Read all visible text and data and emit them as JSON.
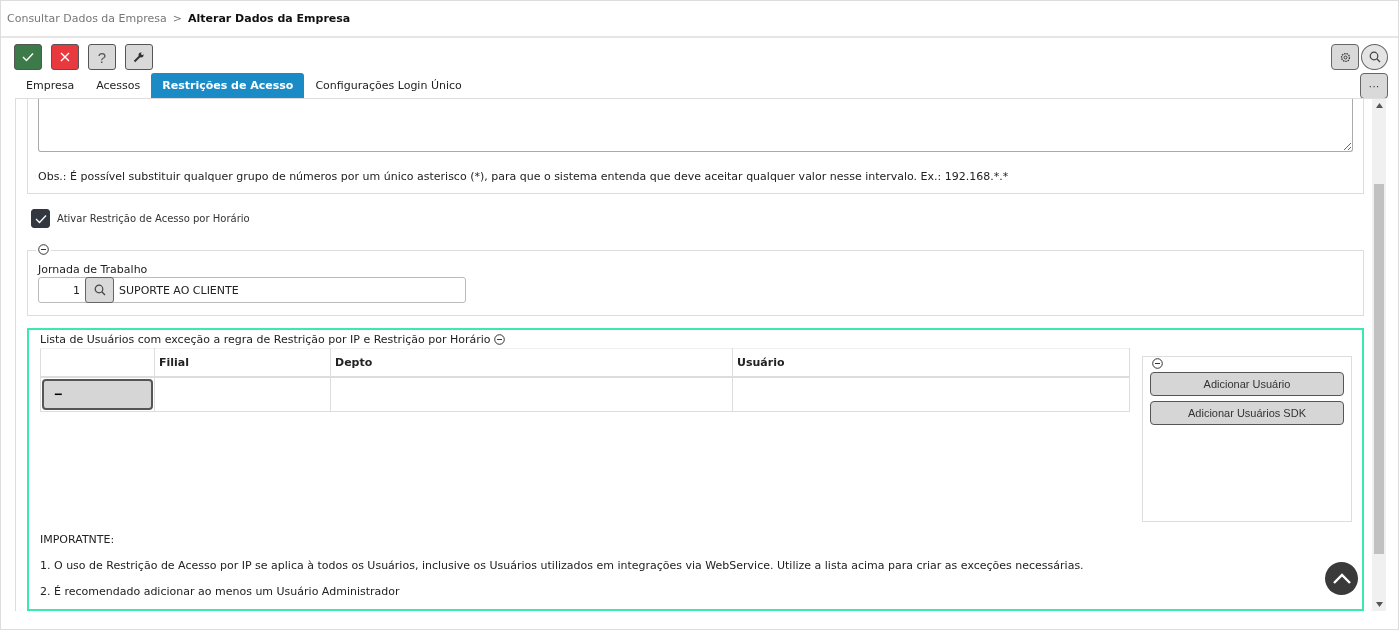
{
  "breadcrumb": [
    {
      "label": "Consultar Dados da Empresa",
      "current": false
    },
    {
      "label": "Alterar Dados da Empresa",
      "current": true
    }
  ],
  "breadcrumb_separator": ">",
  "toolbar": [
    {
      "kind": "confirm"
    },
    {
      "kind": "cancel"
    },
    {
      "kind": "help",
      "label": "?"
    },
    {
      "kind": "tools"
    }
  ],
  "tabs": [
    {
      "label": "Empresa",
      "selected": false
    },
    {
      "label": "Acessos",
      "selected": false
    },
    {
      "label": "Restrições de Acesso",
      "selected": true
    },
    {
      "label": "Configurações Login Único",
      "selected": false
    }
  ],
  "more_button": "···",
  "ip_section": {
    "note": "Obs.: É possível substituir qualquer grupo de números por um único asterisco (*), para que o sistema entenda que deve aceitar qualquer valor nesse intervalo. Ex.: 192.168.*.*"
  },
  "time_restriction": {
    "label": "Ativar Restrição de Acesso por Horário",
    "checked": true
  },
  "work_schedule": {
    "label": "Jornada de Trabalho",
    "code": "1",
    "description": "SUPORTE AO CLIENTE"
  },
  "exceptions": {
    "title": "Lista de Usuários com exceção a regra de Restrição por IP e Restrição por Horário",
    "columns": [
      "Filial",
      "Depto",
      "Usuário"
    ],
    "rows": [
      {
        "action": "−",
        "filial": "",
        "depto": "",
        "usuario": ""
      }
    ],
    "buttons": [
      "Adicionar Usuário",
      "Adicionar Usuários SDK"
    ],
    "notes_heading": "IMPORATNTE:",
    "notes": [
      "1. O uso de Restrição de Acesso por IP se aplica à todos os Usuários, inclusive os Usuários utilizados em integrações via WebService. Utilize a lista acima para criar as exceções necessárias.",
      "2. É recomendado adicionar ao menos um Usuário Administrador"
    ]
  }
}
